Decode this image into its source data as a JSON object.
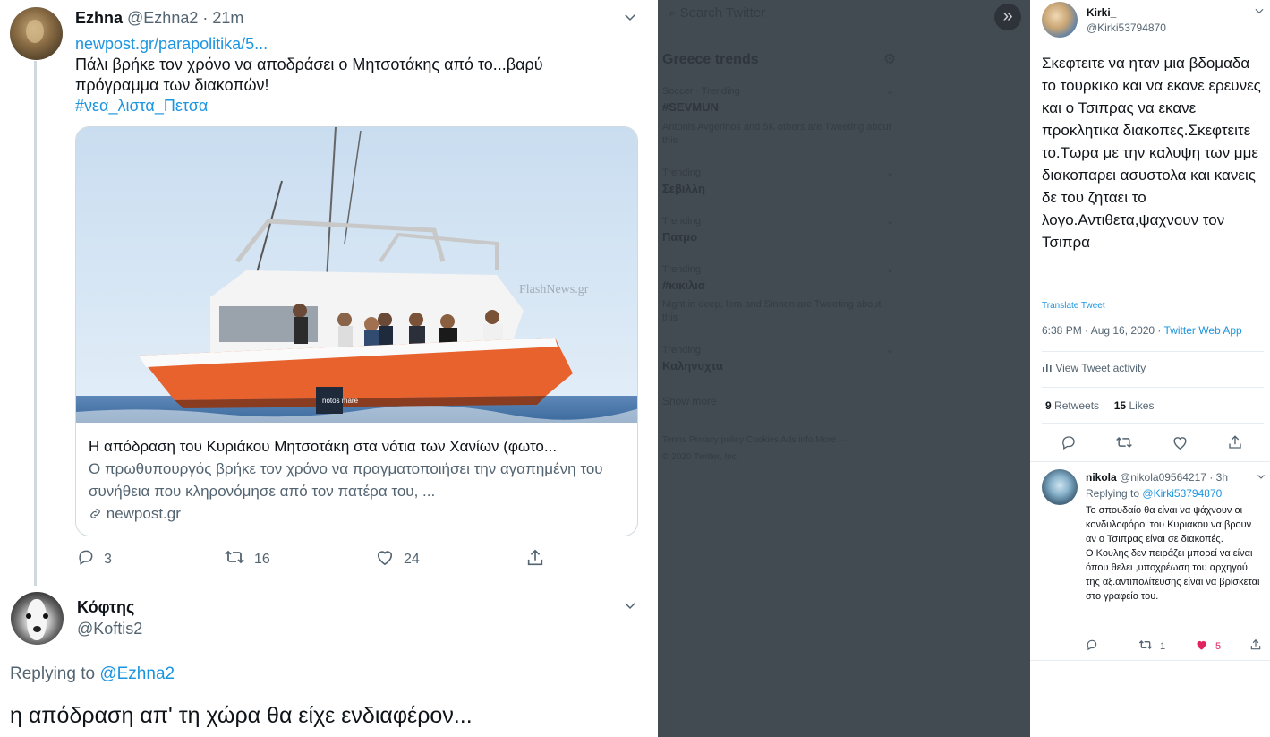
{
  "left": {
    "tweet": {
      "author_name": "Ezhna",
      "author_handle": "@Ezhna2",
      "time": "21m",
      "link_text": "newpost.gr/parapolitika/5...",
      "text": "Πάλι βρήκε τον χρόνο να αποδράσει ο Μητσοτάκης από το...βαρύ πρόγραμμα των διακοπών!",
      "hashtag": "#νεα_λιστα_Πετσα",
      "card": {
        "image_watermark": "FlashNews.gr",
        "boat_label": "notos mare",
        "title": "Η απόδραση του Κυριάκου Μητσοτάκη στα νότια των Χανίων (φωτο...",
        "description": "Ο πρωθυπουργός βρήκε τον χρόνο να πραγματοποιήσει την αγαπημένη του συνήθεια που κληρονόμησε από τον πατέρα του, ...",
        "domain": "newpost.gr"
      },
      "actions": {
        "replies": "3",
        "retweets": "16",
        "likes": "24"
      }
    },
    "reply": {
      "author_name": "Κόφτης",
      "author_handle": "@Koftis2",
      "replying_label": "Replying to",
      "replying_to": "@Ezhna2",
      "text": "η απόδραση  απ' τη χώρα θα είχε ενδιαφέρον..."
    }
  },
  "middle": {
    "search_placeholder": "Search Twitter",
    "trends_title": "Greece trends",
    "trends": [
      {
        "context": "Soccer · Trending",
        "name": "#SEVMUN",
        "sub": "Antonis Avgerinos and 5K others are Tweeting about this"
      },
      {
        "context": "Trending",
        "name": "Σεβιλλη",
        "sub": ""
      },
      {
        "context": "Trending",
        "name": "Πατμο",
        "sub": ""
      },
      {
        "context": "Trending",
        "name": "#κικιλια",
        "sub": "Night in deep, lera and Sinnon are Tweeting about this"
      },
      {
        "context": "Trending",
        "name": "Καληνυχτα",
        "sub": ""
      }
    ],
    "show_more": "Show more",
    "footer_links": "Terms  Privacy policy  Cookies  Ads info  More ···",
    "copyright": "© 2020 Twitter, Inc."
  },
  "right": {
    "tweet": {
      "author_name": "Kirki_",
      "author_handle": "@Kirki53794870",
      "text": "Σκεφτειτε να ηταν μια βδομαδα το τουρκικο και να εκανε ερευνες και ο Τσιπρας να εκανε προκλητικα διακοπες.Σκεφτειτε το.Τωρα με την καλυψη των μμε διακοπαρει ασυστολα και κανεις δε του ζηταει το λογο.Αντιθετα,ψαχνουν τον Τσιπρα",
      "translate": "Translate Tweet",
      "time": "6:38 PM · Aug 16, 2020 · ",
      "source": "Twitter Web App",
      "activity": "View Tweet activity",
      "retweets_count": "9",
      "retweets_label": "Retweets",
      "likes_count": "15",
      "likes_label": "Likes"
    },
    "reply": {
      "author_name": "nikola",
      "author_handle": "@nikola09564217",
      "time": "· 3h",
      "replying_label": "Replying to",
      "replying_to": "@Kirki53794870",
      "text_1": "Το σπουδαίο θα είναι να ψάχνουν οι κονδυλοφόροι του Κυριακου να βρουν αν ο Τσιπρας είναι σε διακοπές.",
      "text_2": "Ο Κουλης δεν πειράζει μπορεί να είναι  όπου θελει ,υποχρέωση του αρχηγού της αξ.αντιπολίτευσης είναι να βρίσκεται στο γραφείο του.",
      "retweets": "1",
      "likes": "5"
    }
  },
  "colors": {
    "link": "#1b95e0",
    "like": "#e0245e",
    "overlay": "#424a52"
  }
}
